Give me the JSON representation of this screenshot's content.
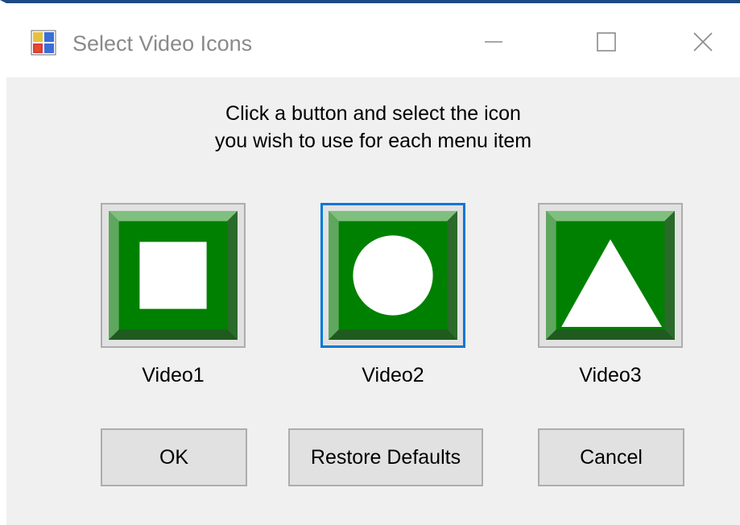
{
  "window": {
    "title": "Select Video Icons"
  },
  "instructions": {
    "line1": "Click a button and select the icon",
    "line2": "you wish to use for each menu item"
  },
  "icons": [
    {
      "label": "Video1",
      "shape": "square-icon",
      "selected": false
    },
    {
      "label": "Video2",
      "shape": "circle-icon",
      "selected": true
    },
    {
      "label": "Video3",
      "shape": "triangle-icon",
      "selected": false
    }
  ],
  "buttons": {
    "ok": "OK",
    "restore": "Restore Defaults",
    "cancel": "Cancel"
  },
  "colors": {
    "icon_green": "#008000",
    "focus_blue": "#0078d7",
    "title_bar_accent": "#1c4a82"
  }
}
